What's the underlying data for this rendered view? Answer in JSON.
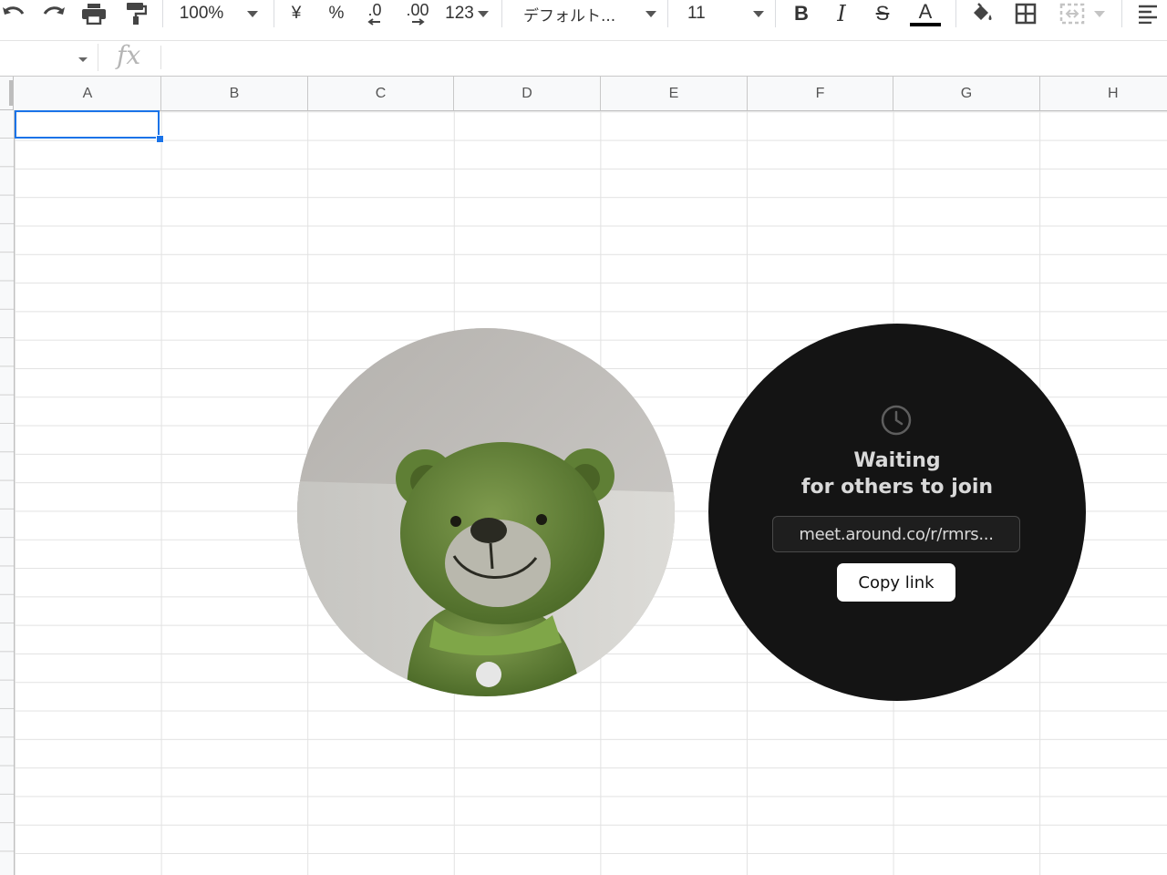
{
  "toolbar": {
    "zoom": "100%",
    "currency": "¥",
    "percent": "%",
    "decrease_decimal": ".0",
    "increase_decimal": ".00",
    "number_format": "123",
    "font_name": "デフォルト...",
    "font_size": "11",
    "bold": "B",
    "italic": "I",
    "strikethrough": "S",
    "text_color": "A",
    "text_color_value": "#000000"
  },
  "formula_bar": {
    "fx_label": "fx",
    "value": ""
  },
  "sheet": {
    "columns": [
      "A",
      "B",
      "C",
      "D",
      "E",
      "F",
      "G",
      "H"
    ],
    "selected_cell": "A1",
    "selection_color": "#1a73e8"
  },
  "call": {
    "waiting_line1": "Waiting",
    "waiting_line2": "for others to join",
    "link": "meet.around.co/r/rmrs...",
    "copy_button": "Copy link",
    "panel_color": "#141414"
  }
}
